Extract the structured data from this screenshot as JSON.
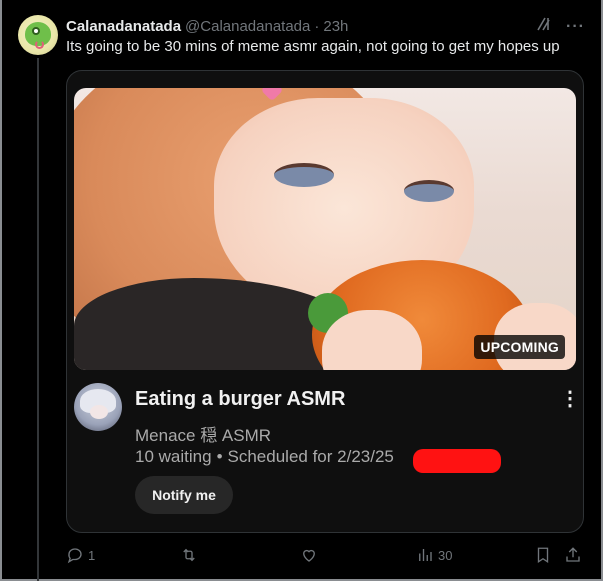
{
  "tweet": {
    "display_name": "Calanadanatada",
    "handle": "@Calanadanatada",
    "separator": "·",
    "time": "23h",
    "text": "Its going to be 30 mins of meme asmr again, not going to get my hopes up",
    "more_icon": "···"
  },
  "card": {
    "badge": "UPCOMING",
    "video_title": "Eating a burger ASMR",
    "channel_name": "Menace 穏 ASMR",
    "waiting": "10 waiting",
    "dot": "•",
    "scheduled": "Scheduled for 2/23/25",
    "notify_label": "Notify me",
    "kebab": "⋮"
  },
  "actions": {
    "reply_count": "1",
    "retweet_count": "",
    "like_count": "",
    "views_count": "30"
  },
  "colors": {
    "background": "#000000",
    "card_bg": "#0f0f0f",
    "border": "#2f3336",
    "muted": "#71767b",
    "redaction": "#ff1212"
  }
}
